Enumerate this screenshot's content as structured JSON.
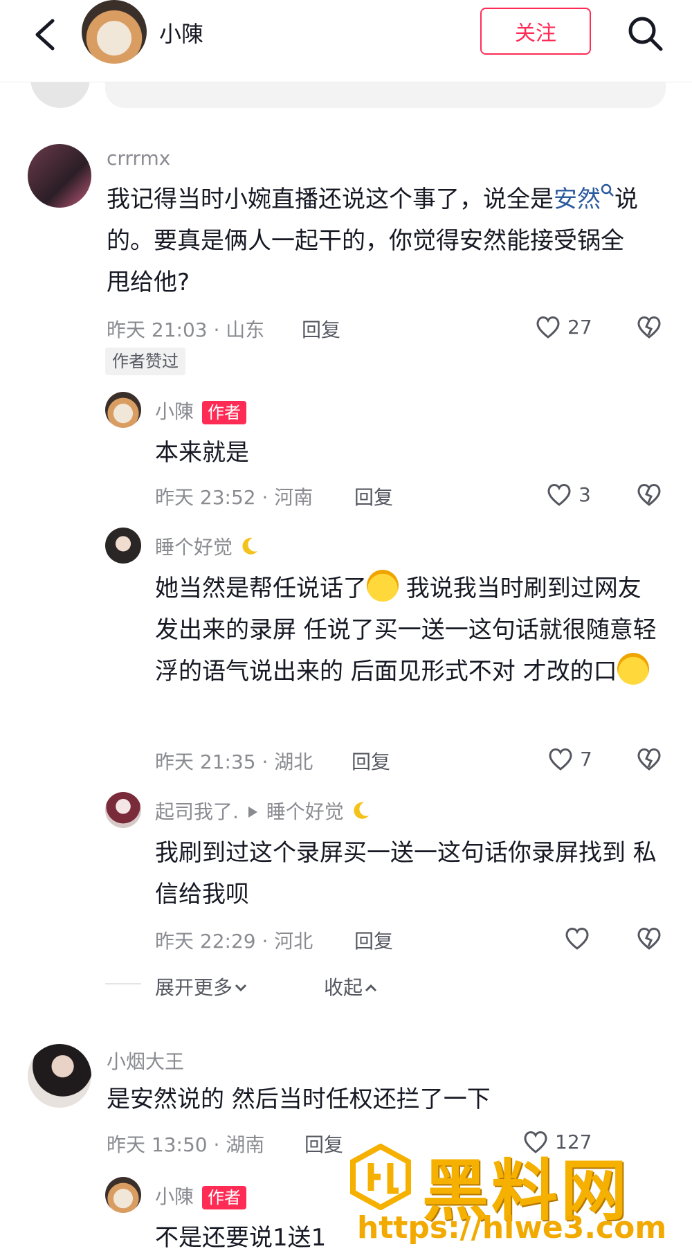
{
  "header": {
    "name": "小陳",
    "follow_label": "关注"
  },
  "comments": [
    {
      "username": "crrrmx",
      "text_a": "我记得当时小婉直播还说这个事了，说全是",
      "text_link": "安然",
      "text_b": "说的。要真是俩人一起干的，你觉得安然能接受锅全甩给他?",
      "meta": "昨天 21:03 · 山东",
      "reply_label": "回复",
      "likes": "27",
      "liked_badge": "作者赞过"
    },
    {
      "username": "小陳",
      "author_badge": "作者",
      "text": "本来就是",
      "meta": "昨天 23:52 · 河南",
      "reply_label": "回复",
      "likes": "3"
    },
    {
      "username": "睡个好觉",
      "text_a": "她当然是帮任说话了",
      "text_b": " 我说我当时刷到过网友发出来的录屏 任说了买一送一这句话就很随意轻浮的语气说出来的 后面见形式不对 才改的口",
      "meta": "昨天 21:35 · 湖北",
      "reply_label": "回复",
      "likes": "7"
    },
    {
      "username": "起司我了.",
      "reply_to": "睡个好觉",
      "text": "我刷到过这个录屏买一送一这句话你录屏找到 私信给我呗",
      "meta": "昨天 22:29 · 河北",
      "reply_label": "回复"
    },
    {
      "username": "小烟大王",
      "text": "是安然说的 然后当时任权还拦了一下",
      "meta": "昨天 13:50 · 湖南",
      "reply_label": "回复",
      "likes": "127"
    },
    {
      "username": "小陳",
      "author_badge": "作者",
      "text": "不是还要说1送1"
    }
  ],
  "expand": {
    "more": "展开更多",
    "collapse": "收起"
  },
  "watermark": {
    "title": "黑料网",
    "url": "https://hlwe3.com"
  },
  "colors": {
    "accent": "#fe2c55",
    "link": "#2b5b9e",
    "watermark": "#f5b000"
  }
}
